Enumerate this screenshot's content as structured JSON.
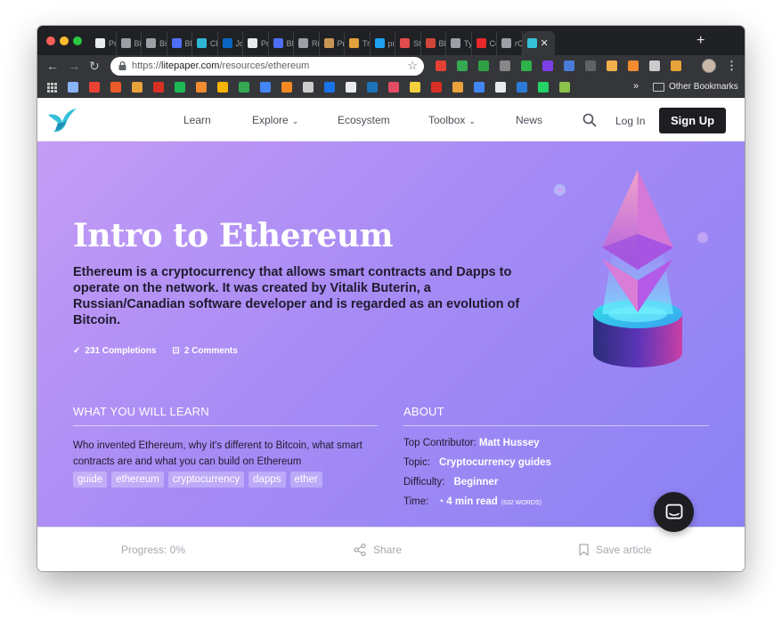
{
  "browser": {
    "tabs": [
      {
        "title": "Pr",
        "color": "#e8eaed"
      },
      {
        "title": "Bi",
        "color": "#9aa0a6"
      },
      {
        "title": "Bi",
        "color": "#9aa0a6"
      },
      {
        "title": "Bl",
        "color": "#4f6ef7"
      },
      {
        "title": "Cl",
        "color": "#2fb6d6"
      },
      {
        "title": "Jo",
        "color": "#0a66c2"
      },
      {
        "title": "Pr",
        "color": "#e8eaed"
      },
      {
        "title": "Bl",
        "color": "#4f6ef7"
      },
      {
        "title": "Ri",
        "color": "#9aa0a6"
      },
      {
        "title": "Pr",
        "color": "#c99555"
      },
      {
        "title": "Tr",
        "color": "#e0a03a"
      },
      {
        "title": "pu",
        "color": "#1da1f2"
      },
      {
        "title": "St",
        "color": "#e24c4c"
      },
      {
        "title": "Bl",
        "color": "#d0453a"
      },
      {
        "title": "Ty",
        "color": "#9aa0a6"
      },
      {
        "title": "Co",
        "color": "#e6292b"
      },
      {
        "title": "rC",
        "color": "#9aa0a6"
      }
    ],
    "active_tab_close": "✕",
    "new_tab": "+",
    "address": {
      "scheme": "https://",
      "host": "litepaper.com",
      "path": "/resources/ethereum"
    },
    "extensions": [
      "#e44135",
      "#34a853",
      "#2ea043",
      "#888888",
      "#2fb14c",
      "#7b3fe4",
      "#4a7bd9",
      "#5f6368",
      "#f1b04c",
      "#f28b30",
      "#cccccc",
      "#e8a23a"
    ],
    "bookmarks": [
      "#8ab4f8",
      "#ea4335",
      "#eb5a29",
      "#e8a23a",
      "#d93025",
      "#1db954",
      "#f28b30",
      "#f4b400",
      "#34a853",
      "#4285f4",
      "#f58a25",
      "#cccccc",
      "#1a73e8",
      "#e8eaed",
      "#1d72b8",
      "#e44c65",
      "#f4d03f",
      "#d93025",
      "#e8a23a",
      "#4285f4",
      "#e8eaed",
      "#2b7bd6",
      "#25d366",
      "#8bc34a"
    ],
    "bookmarks_more": "»",
    "other_bookmarks": "Other Bookmarks"
  },
  "site": {
    "nav": {
      "learn": "Learn",
      "explore": "Explore",
      "ecosystem": "Ecosystem",
      "toolbox": "Toolbox",
      "news": "News",
      "login": "Log In",
      "signup": "Sign Up"
    },
    "hero": {
      "title": "Intro to Ethereum",
      "description": "Ethereum is a cryptocurrency that allows smart contracts and Dapps to operate on the network. It was created by Vitalik Buterin, a Russian/Canadian software developer and is regarded as an evolution of Bitcoin.",
      "completions": "231 Completions",
      "comments": "2 Comments"
    },
    "learn": {
      "heading": "WHAT YOU WILL LEARN",
      "text": "Who invented Ethereum, why it's different to Bitcoin, what smart contracts are and what you can build on Ethereum",
      "tags": [
        "guide",
        "ethereum",
        "cryptocurrency",
        "dapps",
        "ether"
      ]
    },
    "about": {
      "heading": "ABOUT",
      "contributor_label": "Top Contributor:",
      "contributor": "Matt Hussey",
      "topic_label": "Topic:",
      "topic": "Cryptocurrency guides",
      "difficulty_label": "Difficulty:",
      "difficulty": "Beginner",
      "time_label": "Time:",
      "time": "4 min read",
      "words": "(632 WORDS)"
    },
    "bottom": {
      "progress": "Progress: 0%",
      "share": "Share",
      "save": "Save article"
    }
  }
}
